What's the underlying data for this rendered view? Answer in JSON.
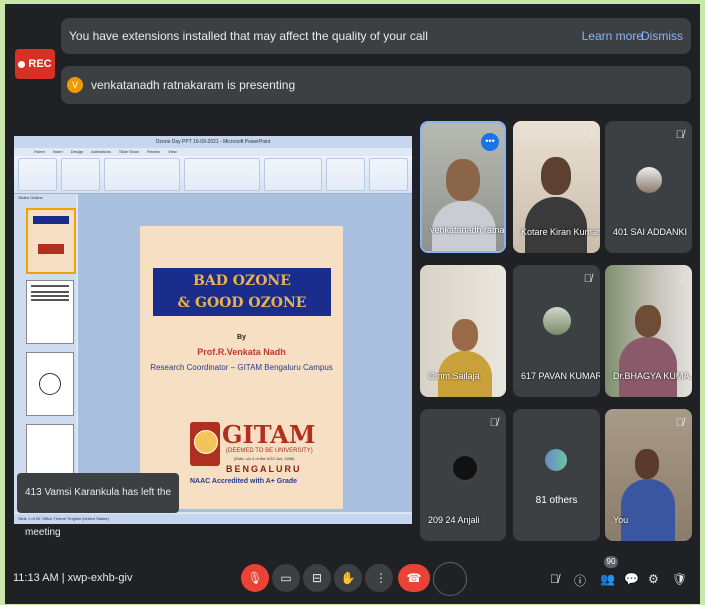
{
  "banner": {
    "message": "You have extensions installed that may affect the quality of your call",
    "learn_more": "Learn more",
    "dismiss": "Dismiss"
  },
  "rec_label": "REC",
  "presenting": {
    "avatar_letter": "V",
    "text": "venkatanadh ratnakaram is presenting"
  },
  "ppt": {
    "window_title": "Ozone Day PPT 16-09-2021 - Microsoft PowerPoint",
    "tabs": [
      "Home",
      "Insert",
      "Design",
      "Animations",
      "Slide Show",
      "Review",
      "View"
    ],
    "pane_tabs": "Slides   Outline",
    "status": "Slide 1 of 50   'Office Theme'   English (United States)"
  },
  "slide": {
    "title_line1": "BAD OZONE",
    "title_line2": "& GOOD OZONE",
    "by": "By",
    "presenter": "Prof.R.Venkata Nadh",
    "role": "Research Coordinator – GITAM Bengaluru Campus",
    "logo_name": "GITAM",
    "deemed": "(DEEMED TO BE UNIVERSITY)",
    "estd": "(Estd. u/s 3 of the UGC Act, 1956)",
    "city": "BENGALURU",
    "naac": "NAAC Accredited with A+ Grade"
  },
  "toast": "413 Vamsi Karankula has left the meeting",
  "participants": [
    {
      "name": "venkatanadh ratna...",
      "muted": false
    },
    {
      "name": "Kotare Kiran Kumar",
      "muted": true
    },
    {
      "name": "401 SAI ADDANKI",
      "muted": true
    },
    {
      "name": "Omm Sailaja",
      "muted": true
    },
    {
      "name": "617 PAVAN KUMAR",
      "muted": true
    },
    {
      "name": "Dr.BHAGYA KUMA...",
      "muted": true
    },
    {
      "name": "209 24 Anjali",
      "muted": true
    },
    {
      "name": "81 others",
      "muted": false
    },
    {
      "name": "You",
      "muted": true
    }
  ],
  "bottom": {
    "time": "11:13 AM",
    "separator": "|",
    "meeting_code": "xwp-exhb-giv",
    "participants_count": "90"
  },
  "colors": {
    "accent": "#8ab4f8",
    "danger": "#ea4335",
    "surface": "#3c4043",
    "background": "#202124"
  }
}
